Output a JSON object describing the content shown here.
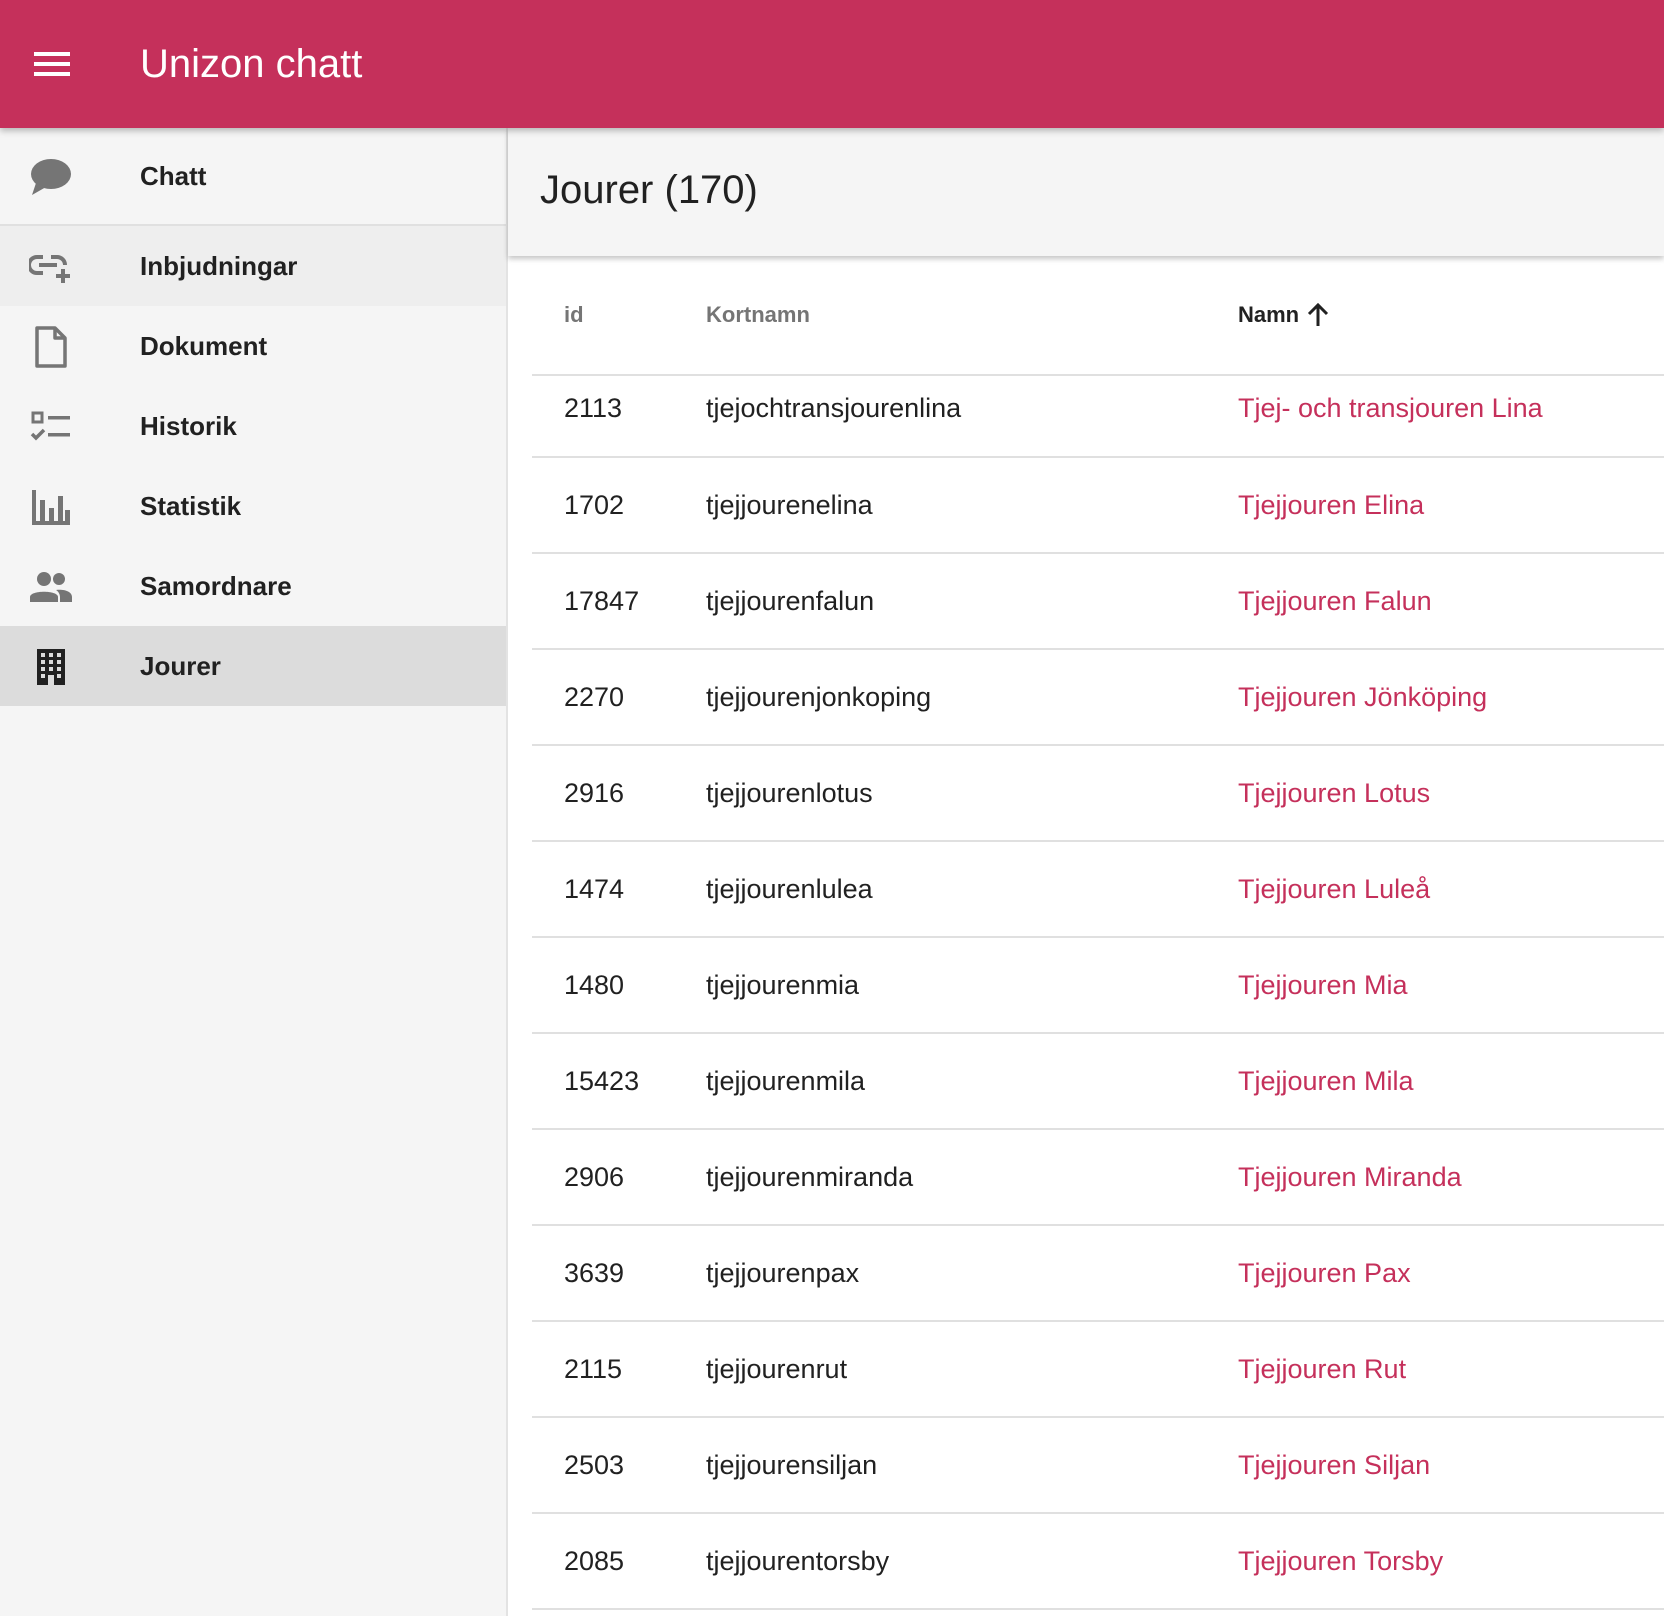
{
  "app": {
    "title": "Unizon chatt"
  },
  "nav": {
    "items": [
      {
        "label": "Chatt",
        "icon": "chat-bubble-icon"
      },
      {
        "label": "Inbjudningar",
        "icon": "link-add-icon"
      },
      {
        "label": "Dokument",
        "icon": "document-icon"
      },
      {
        "label": "Historik",
        "icon": "checklist-icon"
      },
      {
        "label": "Statistik",
        "icon": "bar-chart-icon"
      },
      {
        "label": "Samordnare",
        "icon": "people-icon"
      },
      {
        "label": "Jourer",
        "icon": "building-icon"
      }
    ],
    "active": "Jourer"
  },
  "page": {
    "title": "Jourer (170)"
  },
  "table": {
    "columns": {
      "id": "id",
      "kortnamn": "Kortnamn",
      "namn": "Namn"
    },
    "sort": {
      "column": "Namn",
      "direction": "ascending"
    },
    "rows": [
      {
        "id": "2113",
        "kortnamn": "tjejochtransjourenlina",
        "namn": "Tjej- och transjouren Lina"
      },
      {
        "id": "1702",
        "kortnamn": "tjejjourenelina",
        "namn": "Tjejjouren Elina"
      },
      {
        "id": "17847",
        "kortnamn": "tjejjourenfalun",
        "namn": "Tjejjouren Falun"
      },
      {
        "id": "2270",
        "kortnamn": "tjejjourenjonkoping",
        "namn": "Tjejjouren Jönköping"
      },
      {
        "id": "2916",
        "kortnamn": "tjejjourenlotus",
        "namn": "Tjejjouren Lotus"
      },
      {
        "id": "1474",
        "kortnamn": "tjejjourenlulea",
        "namn": "Tjejjouren Luleå"
      },
      {
        "id": "1480",
        "kortnamn": "tjejjourenmia",
        "namn": "Tjejjouren Mia"
      },
      {
        "id": "15423",
        "kortnamn": "tjejjourenmila",
        "namn": "Tjejjouren Mila"
      },
      {
        "id": "2906",
        "kortnamn": "tjejjourenmiranda",
        "namn": "Tjejjouren Miranda"
      },
      {
        "id": "3639",
        "kortnamn": "tjejjourenpax",
        "namn": "Tjejjouren Pax"
      },
      {
        "id": "2115",
        "kortnamn": "tjejjourenrut",
        "namn": "Tjejjouren Rut"
      },
      {
        "id": "2503",
        "kortnamn": "tjejjourensiljan",
        "namn": "Tjejjouren Siljan"
      },
      {
        "id": "2085",
        "kortnamn": "tjejjourentorsby",
        "namn": "Tjejjouren Torsby"
      }
    ]
  },
  "colors": {
    "brand": "#c5305b",
    "sidebar_bg": "#f5f5f5",
    "active_item_bg": "#dcdcdc"
  }
}
